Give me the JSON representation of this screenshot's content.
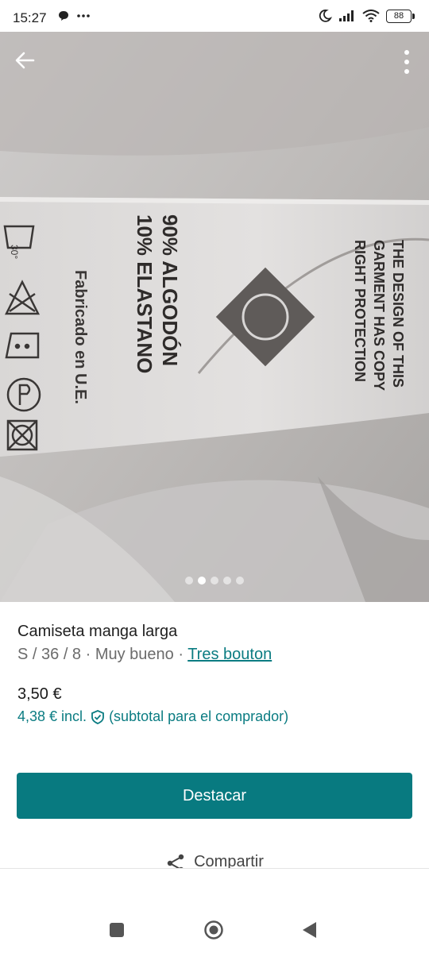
{
  "status_bar": {
    "time": "15:27",
    "left_icons": [
      "chat-bubble-icon",
      "more-horizontal-icon"
    ],
    "right_icons": [
      "moon-icon",
      "signal-icon",
      "wifi-icon",
      "battery-icon"
    ],
    "battery_level": "88"
  },
  "photo": {
    "top_bar": {
      "back_icon": "arrow-left-icon",
      "more_icon": "more-vertical-icon"
    },
    "label_text": {
      "composition_line1": "90% ALGODÓN",
      "composition_line2": "10% ELASTANO",
      "origin": "Fabricado en U.E.",
      "copyright_line1": "THE DESIGN OF THIS",
      "copyright_line2": "GARMENT HAS COPY",
      "copyright_line3": "RIGHT PROTECTION",
      "wash_symbol": "30°"
    },
    "carousel": {
      "count": 5,
      "active_index": 1
    }
  },
  "listing": {
    "title": "Camiseta manga larga",
    "meta_prefix": "S / 36 / 8 · Muy bueno · ",
    "brand": "Tres bouton",
    "price": "3,50 €",
    "buyer_price": "4,38 € incl.",
    "buyer_note": "(subtotal para el comprador)",
    "colors": {
      "accent": "#087a80",
      "link": "#0b7c82"
    }
  },
  "actions": {
    "primary_label": "Destacar",
    "share_label": "Compartir"
  },
  "nav_bar": {
    "icons": [
      "square-recents-icon",
      "circle-home-icon",
      "triangle-back-icon"
    ]
  }
}
